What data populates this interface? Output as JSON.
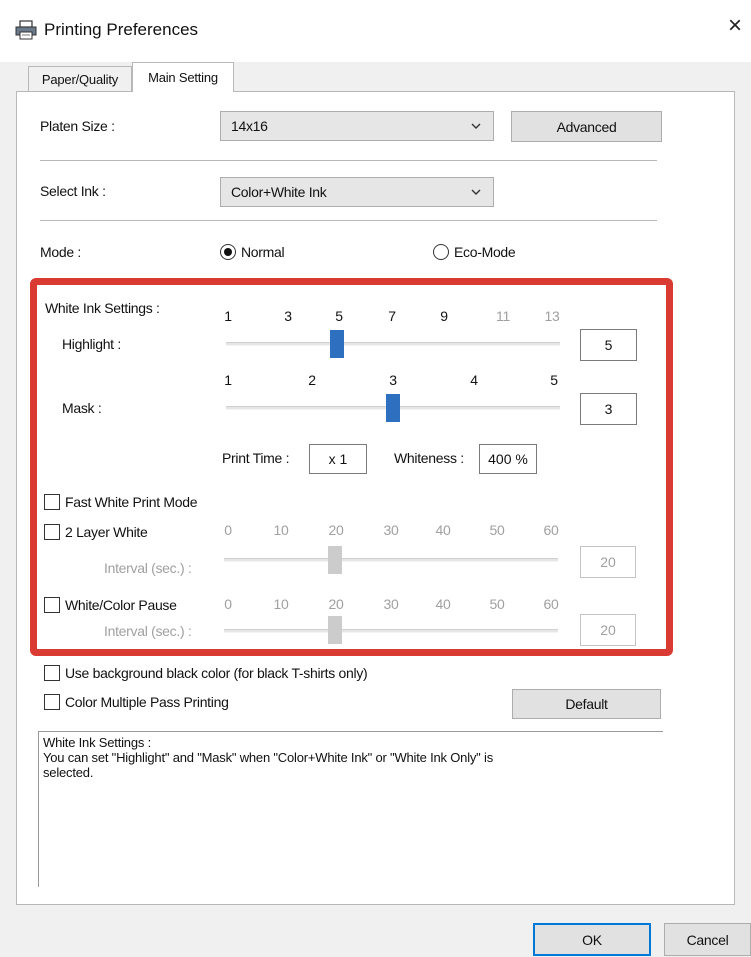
{
  "window": {
    "title": "Printing Preferences",
    "close_glyph": "×"
  },
  "tabs": [
    {
      "label": "Paper/Quality"
    },
    {
      "label": "Main Setting"
    }
  ],
  "platen": {
    "label": "Platen Size :",
    "value": "14x16",
    "advanced_label": "Advanced"
  },
  "ink": {
    "label": "Select Ink :",
    "value": "Color+White Ink"
  },
  "mode": {
    "label": "Mode :",
    "normal": "Normal",
    "eco": "Eco-Mode",
    "selected": "Normal"
  },
  "white_ink": {
    "section_label": "White Ink Settings :",
    "highlight": {
      "label": "Highlight :",
      "ticks": [
        "1",
        "3",
        "5",
        "7",
        "9",
        "11",
        "13"
      ],
      "enabled_ticks": 5,
      "min": 1,
      "max": 13,
      "value": 5,
      "value_text": "5"
    },
    "mask": {
      "label": "Mask :",
      "ticks": [
        "1",
        "2",
        "3",
        "4",
        "5"
      ],
      "min": 1,
      "max": 5,
      "value": 3,
      "value_text": "3"
    },
    "print_time": {
      "label": "Print Time :",
      "value": "x 1"
    },
    "whiteness": {
      "label": "Whiteness :",
      "value": "400 %"
    }
  },
  "options": {
    "fast_white": {
      "label": "Fast White Print Mode",
      "checked": false
    },
    "two_layer": {
      "label": "2 Layer White",
      "checked": false,
      "interval_label": "Interval (sec.) :",
      "ticks": [
        "0",
        "10",
        "20",
        "30",
        "40",
        "50",
        "60"
      ],
      "min": 0,
      "max": 60,
      "value": 20,
      "value_text": "20"
    },
    "pause": {
      "label": "White/Color Pause",
      "checked": false,
      "interval_label": "Interval (sec.) :",
      "ticks": [
        "0",
        "10",
        "20",
        "30",
        "40",
        "50",
        "60"
      ],
      "min": 0,
      "max": 60,
      "value": 20,
      "value_text": "20"
    },
    "black_bg": {
      "label": "Use background black color (for black T-shirts only)",
      "checked": false
    },
    "multi_pass": {
      "label": "Color Multiple Pass Printing",
      "checked": false
    }
  },
  "default_label": "Default",
  "description": {
    "line1": "White Ink Settings :",
    "line2": "You can set \"Highlight\" and \"Mask\" when \"Color+White Ink\" or \"White Ink Only\" is",
    "line3": "selected."
  },
  "footer": {
    "ok_label": "OK",
    "cancel_label": "Cancel"
  },
  "colors": {
    "highlight_box": "#d93a32",
    "slider_thumb": "#2f6fbf"
  }
}
